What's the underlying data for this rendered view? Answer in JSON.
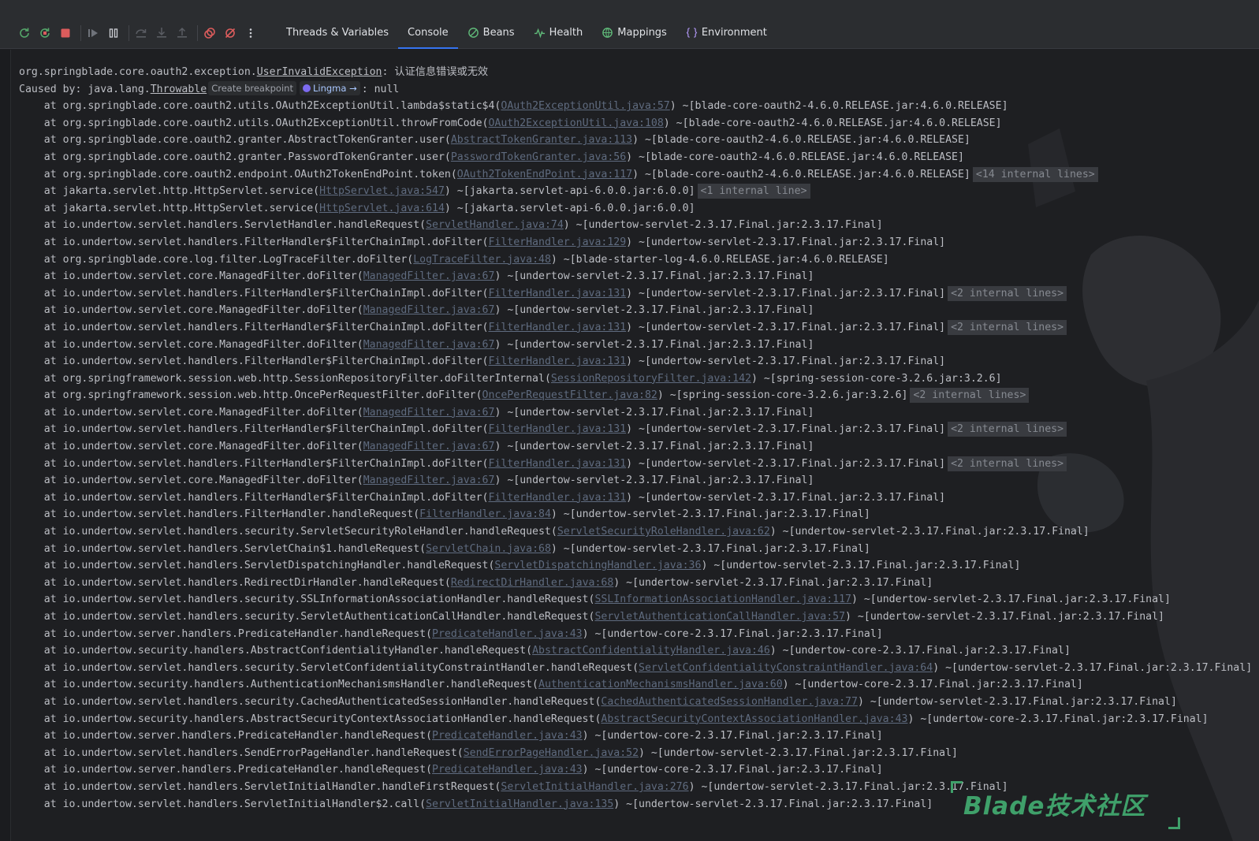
{
  "toolbar": {
    "icons": [
      "rerun-icon",
      "restart-icon",
      "stop-icon",
      "resume-icon",
      "pause-icon",
      "step-over-icon",
      "step-into-icon",
      "step-out-icon",
      "view-breakpoints-icon",
      "mute-breakpoints-icon",
      "more-icon"
    ],
    "tabs": [
      {
        "label": "Threads & Variables",
        "icon": "",
        "active": false
      },
      {
        "label": "Console",
        "icon": "",
        "active": true
      },
      {
        "label": "Beans",
        "icon": "beans-icon",
        "active": false
      },
      {
        "label": "Health",
        "icon": "health-icon",
        "active": false
      },
      {
        "label": "Mappings",
        "icon": "mappings-icon",
        "active": false
      },
      {
        "label": "Environment",
        "icon": "environment-icon",
        "active": false
      }
    ]
  },
  "colors": {
    "background": "#1e1f22",
    "toolbar": "#2b2d30",
    "text": "#bcbec4",
    "link": "#5f6b7f",
    "accent": "#3574f0",
    "stop_red": "#db5c5c",
    "watermark_green": "#3fa06a"
  },
  "console": {
    "header": [
      {
        "parts": [
          {
            "t": "org.springblade.core.oauth2.exception."
          },
          {
            "t": "UserInvalidException",
            "ex": true
          },
          {
            "t": ": 认证信息错误或无效"
          }
        ]
      },
      {
        "parts": [
          {
            "t": "Caused by: java.lang."
          },
          {
            "t": "Throwable",
            "ex": true
          },
          {
            "inlay": "Create breakpoint"
          },
          {
            "inlay": "Lingma →",
            "lingma": true
          },
          {
            "t": ": null"
          }
        ]
      }
    ],
    "frames": [
      {
        "method": "org.springblade.core.oauth2.utils.OAuth2ExceptionUtil.lambda$static$4",
        "src": "OAuth2ExceptionUtil.java:57",
        "jar": "blade-core-oauth2-4.6.0.RELEASE.jar:4.6.0.RELEASE",
        "fold": false,
        "internal": ""
      },
      {
        "method": "org.springblade.core.oauth2.utils.OAuth2ExceptionUtil.throwFromCode",
        "src": "OAuth2ExceptionUtil.java:108",
        "jar": "blade-core-oauth2-4.6.0.RELEASE.jar:4.6.0.RELEASE",
        "fold": false,
        "internal": ""
      },
      {
        "method": "org.springblade.core.oauth2.granter.AbstractTokenGranter.user",
        "src": "AbstractTokenGranter.java:113",
        "jar": "blade-core-oauth2-4.6.0.RELEASE.jar:4.6.0.RELEASE",
        "fold": false,
        "internal": ""
      },
      {
        "method": "org.springblade.core.oauth2.granter.PasswordTokenGranter.user",
        "src": "PasswordTokenGranter.java:56",
        "jar": "blade-core-oauth2-4.6.0.RELEASE.jar:4.6.0.RELEASE",
        "fold": false,
        "internal": ""
      },
      {
        "method": "org.springblade.core.oauth2.endpoint.OAuth2TokenEndPoint.token",
        "src": "OAuth2TokenEndPoint.java:117",
        "jar": "blade-core-oauth2-4.6.0.RELEASE.jar:4.6.0.RELEASE",
        "fold": true,
        "internal": "<14 internal lines>"
      },
      {
        "method": "jakarta.servlet.http.HttpServlet.service",
        "src": "HttpServlet.java:547",
        "jar": "jakarta.servlet-api-6.0.0.jar:6.0.0",
        "fold": true,
        "internal": "<1 internal line>"
      },
      {
        "method": "jakarta.servlet.http.HttpServlet.service",
        "src": "HttpServlet.java:614",
        "jar": "jakarta.servlet-api-6.0.0.jar:6.0.0",
        "fold": false,
        "internal": ""
      },
      {
        "method": "io.undertow.servlet.handlers.ServletHandler.handleRequest",
        "src": "ServletHandler.java:74",
        "jar": "undertow-servlet-2.3.17.Final.jar:2.3.17.Final",
        "fold": false,
        "internal": ""
      },
      {
        "method": "io.undertow.servlet.handlers.FilterHandler$FilterChainImpl.doFilter",
        "src": "FilterHandler.java:129",
        "jar": "undertow-servlet-2.3.17.Final.jar:2.3.17.Final",
        "fold": false,
        "internal": ""
      },
      {
        "method": "org.springblade.core.log.filter.LogTraceFilter.doFilter",
        "src": "LogTraceFilter.java:48",
        "jar": "blade-starter-log-4.6.0.RELEASE.jar:4.6.0.RELEASE",
        "fold": false,
        "internal": ""
      },
      {
        "method": "io.undertow.servlet.core.ManagedFilter.doFilter",
        "src": "ManagedFilter.java:67",
        "jar": "undertow-servlet-2.3.17.Final.jar:2.3.17.Final",
        "fold": false,
        "internal": ""
      },
      {
        "method": "io.undertow.servlet.handlers.FilterHandler$FilterChainImpl.doFilter",
        "src": "FilterHandler.java:131",
        "jar": "undertow-servlet-2.3.17.Final.jar:2.3.17.Final",
        "fold": true,
        "internal": "<2 internal lines>"
      },
      {
        "method": "io.undertow.servlet.core.ManagedFilter.doFilter",
        "src": "ManagedFilter.java:67",
        "jar": "undertow-servlet-2.3.17.Final.jar:2.3.17.Final",
        "fold": false,
        "internal": ""
      },
      {
        "method": "io.undertow.servlet.handlers.FilterHandler$FilterChainImpl.doFilter",
        "src": "FilterHandler.java:131",
        "jar": "undertow-servlet-2.3.17.Final.jar:2.3.17.Final",
        "fold": true,
        "internal": "<2 internal lines>"
      },
      {
        "method": "io.undertow.servlet.core.ManagedFilter.doFilter",
        "src": "ManagedFilter.java:67",
        "jar": "undertow-servlet-2.3.17.Final.jar:2.3.17.Final",
        "fold": false,
        "internal": ""
      },
      {
        "method": "io.undertow.servlet.handlers.FilterHandler$FilterChainImpl.doFilter",
        "src": "FilterHandler.java:131",
        "jar": "undertow-servlet-2.3.17.Final.jar:2.3.17.Final",
        "fold": false,
        "internal": ""
      },
      {
        "method": "org.springframework.session.web.http.SessionRepositoryFilter.doFilterInternal",
        "src": "SessionRepositoryFilter.java:142",
        "jar": "spring-session-core-3.2.6.jar:3.2.6",
        "fold": false,
        "internal": ""
      },
      {
        "method": "org.springframework.session.web.http.OncePerRequestFilter.doFilter",
        "src": "OncePerRequestFilter.java:82",
        "jar": "spring-session-core-3.2.6.jar:3.2.6",
        "fold": true,
        "internal": "<2 internal lines>"
      },
      {
        "method": "io.undertow.servlet.core.ManagedFilter.doFilter",
        "src": "ManagedFilter.java:67",
        "jar": "undertow-servlet-2.3.17.Final.jar:2.3.17.Final",
        "fold": false,
        "internal": ""
      },
      {
        "method": "io.undertow.servlet.handlers.FilterHandler$FilterChainImpl.doFilter",
        "src": "FilterHandler.java:131",
        "jar": "undertow-servlet-2.3.17.Final.jar:2.3.17.Final",
        "fold": true,
        "internal": "<2 internal lines>"
      },
      {
        "method": "io.undertow.servlet.core.ManagedFilter.doFilter",
        "src": "ManagedFilter.java:67",
        "jar": "undertow-servlet-2.3.17.Final.jar:2.3.17.Final",
        "fold": false,
        "internal": ""
      },
      {
        "method": "io.undertow.servlet.handlers.FilterHandler$FilterChainImpl.doFilter",
        "src": "FilterHandler.java:131",
        "jar": "undertow-servlet-2.3.17.Final.jar:2.3.17.Final",
        "fold": true,
        "internal": "<2 internal lines>"
      },
      {
        "method": "io.undertow.servlet.core.ManagedFilter.doFilter",
        "src": "ManagedFilter.java:67",
        "jar": "undertow-servlet-2.3.17.Final.jar:2.3.17.Final",
        "fold": false,
        "internal": ""
      },
      {
        "method": "io.undertow.servlet.handlers.FilterHandler$FilterChainImpl.doFilter",
        "src": "FilterHandler.java:131",
        "jar": "undertow-servlet-2.3.17.Final.jar:2.3.17.Final",
        "fold": false,
        "internal": ""
      },
      {
        "method": "io.undertow.servlet.handlers.FilterHandler.handleRequest",
        "src": "FilterHandler.java:84",
        "jar": "undertow-servlet-2.3.17.Final.jar:2.3.17.Final",
        "fold": false,
        "internal": ""
      },
      {
        "method": "io.undertow.servlet.handlers.security.ServletSecurityRoleHandler.handleRequest",
        "src": "ServletSecurityRoleHandler.java:62",
        "jar": "undertow-servlet-2.3.17.Final.jar:2.3.17.Final",
        "fold": false,
        "internal": ""
      },
      {
        "method": "io.undertow.servlet.handlers.ServletChain$1.handleRequest",
        "src": "ServletChain.java:68",
        "jar": "undertow-servlet-2.3.17.Final.jar:2.3.17.Final",
        "fold": false,
        "internal": ""
      },
      {
        "method": "io.undertow.servlet.handlers.ServletDispatchingHandler.handleRequest",
        "src": "ServletDispatchingHandler.java:36",
        "jar": "undertow-servlet-2.3.17.Final.jar:2.3.17.Final",
        "fold": false,
        "internal": ""
      },
      {
        "method": "io.undertow.servlet.handlers.RedirectDirHandler.handleRequest",
        "src": "RedirectDirHandler.java:68",
        "jar": "undertow-servlet-2.3.17.Final.jar:2.3.17.Final",
        "fold": false,
        "internal": ""
      },
      {
        "method": "io.undertow.servlet.handlers.security.SSLInformationAssociationHandler.handleRequest",
        "src": "SSLInformationAssociationHandler.java:117",
        "jar": "undertow-servlet-2.3.17.Final.jar:2.3.17.Final",
        "fold": false,
        "internal": ""
      },
      {
        "method": "io.undertow.servlet.handlers.security.ServletAuthenticationCallHandler.handleRequest",
        "src": "ServletAuthenticationCallHandler.java:57",
        "jar": "undertow-servlet-2.3.17.Final.jar:2.3.17.Final",
        "fold": false,
        "internal": ""
      },
      {
        "method": "io.undertow.server.handlers.PredicateHandler.handleRequest",
        "src": "PredicateHandler.java:43",
        "jar": "undertow-core-2.3.17.Final.jar:2.3.17.Final",
        "fold": false,
        "internal": ""
      },
      {
        "method": "io.undertow.security.handlers.AbstractConfidentialityHandler.handleRequest",
        "src": "AbstractConfidentialityHandler.java:46",
        "jar": "undertow-core-2.3.17.Final.jar:2.3.17.Final",
        "fold": false,
        "internal": ""
      },
      {
        "method": "io.undertow.servlet.handlers.security.ServletConfidentialityConstraintHandler.handleRequest",
        "src": "ServletConfidentialityConstraintHandler.java:64",
        "jar": "undertow-servlet-2.3.17.Final.jar:2.3.17.Final",
        "fold": false,
        "internal": ""
      },
      {
        "method": "io.undertow.security.handlers.AuthenticationMechanismsHandler.handleRequest",
        "src": "AuthenticationMechanismsHandler.java:60",
        "jar": "undertow-core-2.3.17.Final.jar:2.3.17.Final",
        "fold": false,
        "internal": ""
      },
      {
        "method": "io.undertow.servlet.handlers.security.CachedAuthenticatedSessionHandler.handleRequest",
        "src": "CachedAuthenticatedSessionHandler.java:77",
        "jar": "undertow-servlet-2.3.17.Final.jar:2.3.17.Final",
        "fold": false,
        "internal": ""
      },
      {
        "method": "io.undertow.security.handlers.AbstractSecurityContextAssociationHandler.handleRequest",
        "src": "AbstractSecurityContextAssociationHandler.java:43",
        "jar": "undertow-core-2.3.17.Final.jar:2.3.17.Final",
        "fold": false,
        "internal": ""
      },
      {
        "method": "io.undertow.server.handlers.PredicateHandler.handleRequest",
        "src": "PredicateHandler.java:43",
        "jar": "undertow-core-2.3.17.Final.jar:2.3.17.Final",
        "fold": false,
        "internal": ""
      },
      {
        "method": "io.undertow.servlet.handlers.SendErrorPageHandler.handleRequest",
        "src": "SendErrorPageHandler.java:52",
        "jar": "undertow-servlet-2.3.17.Final.jar:2.3.17.Final",
        "fold": false,
        "internal": ""
      },
      {
        "method": "io.undertow.server.handlers.PredicateHandler.handleRequest",
        "src": "PredicateHandler.java:43",
        "jar": "undertow-core-2.3.17.Final.jar:2.3.17.Final",
        "fold": false,
        "internal": ""
      },
      {
        "method": "io.undertow.servlet.handlers.ServletInitialHandler.handleFirstRequest",
        "src": "ServletInitialHandler.java:276",
        "jar": "undertow-servlet-2.3.17.Final.jar:2.3.17.Final",
        "fold": false,
        "internal": ""
      },
      {
        "method": "io.undertow.servlet.handlers.ServletInitialHandler$2.call",
        "src": "ServletInitialHandler.java:135",
        "jar": "undertow-servlet-2.3.17.Final.jar:2.3.17.Final",
        "fold": false,
        "internal": ""
      }
    ]
  },
  "watermark": {
    "text": "Blade技术社区"
  }
}
